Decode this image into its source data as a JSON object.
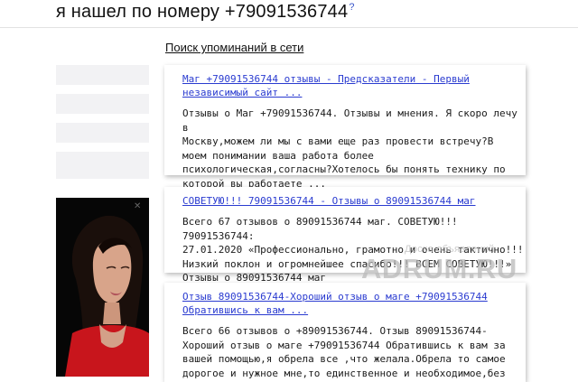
{
  "header": {
    "title": "я нашел по номеру +79091536744",
    "help_mark": "?"
  },
  "main": {
    "mentions_link": "Поиск упоминаний в сети",
    "results": [
      {
        "title": "Маг +79091536744 отзывы - Предсказатели - Первый\nнезависимый сайт ...",
        "snippet": "Отзывы о Маг +79091536744. Отзывы и мнения. Я скоро лечу в\nМоскву,можем ли мы с вами еще раз провести встречу?В\nмоем понимании ваша работа более\nпсихологическая,согласны?Хотелось бы понять технику по\nкоторой вы работаете ..."
      },
      {
        "title": "СОВЕТУЮ!!! 79091536744 - Отзывы о 89091536744 маг",
        "snippet": "Всего 67 отзывов о 89091536744 маг. СОВЕТУЮ!!! 79091536744:\n27.01.2020 «Профессионально, грамотно и очень тактично!!!\nНизкий поклон и огромнейшее спасибо!!! ВСЕМ СОВЕТУЮ!!!»\nОтзывы о 89091536744 маг"
      },
      {
        "title": "Отзыв 89091536744-Хороший отзыв о маге +79091536744\nОбратившись к вам ...",
        "snippet": "Всего 66 отзывов о +89091536744. Отзыв 89091536744-\nХороший отзыв о маге +79091536744 Обратившись к вам за\nвашей помощью,я обрела все ,что желала.Обрела то самое\nдорогое и нужное мне,то единственное и необходимое,без"
      }
    ]
  },
  "watermark": {
    "small": "Доска объявлений",
    "big": "ADRUM.RU"
  },
  "colors": {
    "link": "#2a3bd0",
    "sidebar": "#f2f2f4"
  }
}
